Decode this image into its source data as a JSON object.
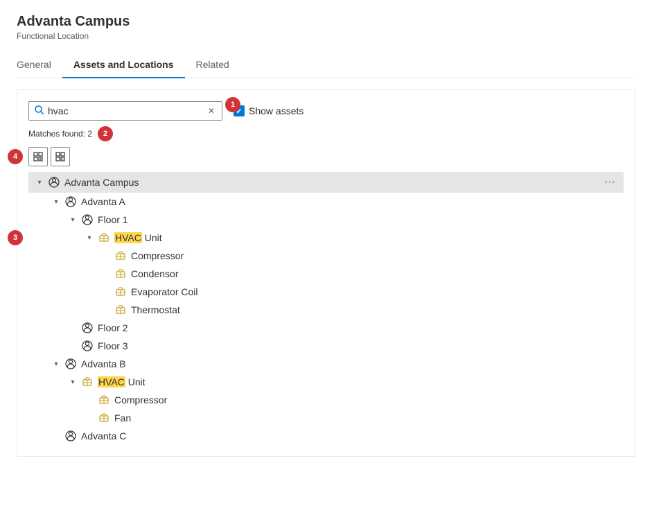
{
  "page": {
    "title": "Advanta Campus",
    "subtitle": "Functional Location"
  },
  "tabs": [
    {
      "id": "general",
      "label": "General",
      "active": false
    },
    {
      "id": "assets-locations",
      "label": "Assets and Locations",
      "active": true
    },
    {
      "id": "related",
      "label": "Related",
      "active": false
    }
  ],
  "search": {
    "value": "hvac",
    "placeholder": "Search...",
    "show_assets_label": "Show assets",
    "matches_label": "Matches found: 2"
  },
  "callouts": {
    "c1": "1",
    "c2": "2",
    "c3": "3",
    "c4": "4"
  },
  "tree": [
    {
      "id": "advanta-campus",
      "label": "Advanta Campus",
      "indent": 1,
      "chevron": "down",
      "type": "location",
      "highlighted": true,
      "more": true,
      "children": [
        {
          "id": "advanta-a",
          "label": "Advanta A",
          "indent": 2,
          "chevron": "down",
          "type": "location",
          "children": [
            {
              "id": "floor-1",
              "label": "Floor 1",
              "indent": 3,
              "chevron": "down",
              "type": "location",
              "children": [
                {
                  "id": "hvac-unit-1",
                  "label_prefix": "HVAC",
                  "label_suffix": " Unit",
                  "indent": 4,
                  "chevron": "down",
                  "type": "asset",
                  "callout": "3",
                  "children": [
                    {
                      "id": "compressor-1",
                      "label": "Compressor",
                      "indent": 5,
                      "chevron": "none",
                      "type": "asset"
                    },
                    {
                      "id": "condensor-1",
                      "label": "Condensor",
                      "indent": 5,
                      "chevron": "none",
                      "type": "asset"
                    },
                    {
                      "id": "evaporator-coil-1",
                      "label": "Evaporator Coil",
                      "indent": 5,
                      "chevron": "none",
                      "type": "asset"
                    },
                    {
                      "id": "thermostat-1",
                      "label": "Thermostat",
                      "indent": 5,
                      "chevron": "none",
                      "type": "asset"
                    }
                  ]
                }
              ]
            },
            {
              "id": "floor-2",
              "label": "Floor 2",
              "indent": 3,
              "chevron": "none",
              "type": "location"
            },
            {
              "id": "floor-3",
              "label": "Floor 3",
              "indent": 3,
              "chevron": "none",
              "type": "location"
            }
          ]
        },
        {
          "id": "advanta-b",
          "label": "Advanta B",
          "indent": 2,
          "chevron": "down",
          "type": "location",
          "children": [
            {
              "id": "hvac-unit-2",
              "label_prefix": "HVAC",
              "label_suffix": " Unit",
              "indent": 3,
              "chevron": "down",
              "type": "asset",
              "children": [
                {
                  "id": "compressor-2",
                  "label": "Compressor",
                  "indent": 4,
                  "chevron": "none",
                  "type": "asset"
                },
                {
                  "id": "fan-1",
                  "label": "Fan",
                  "indent": 4,
                  "chevron": "none",
                  "type": "asset"
                }
              ]
            }
          ]
        },
        {
          "id": "advanta-c",
          "label": "Advanta C",
          "indent": 2,
          "chevron": "none",
          "type": "location"
        }
      ]
    }
  ]
}
